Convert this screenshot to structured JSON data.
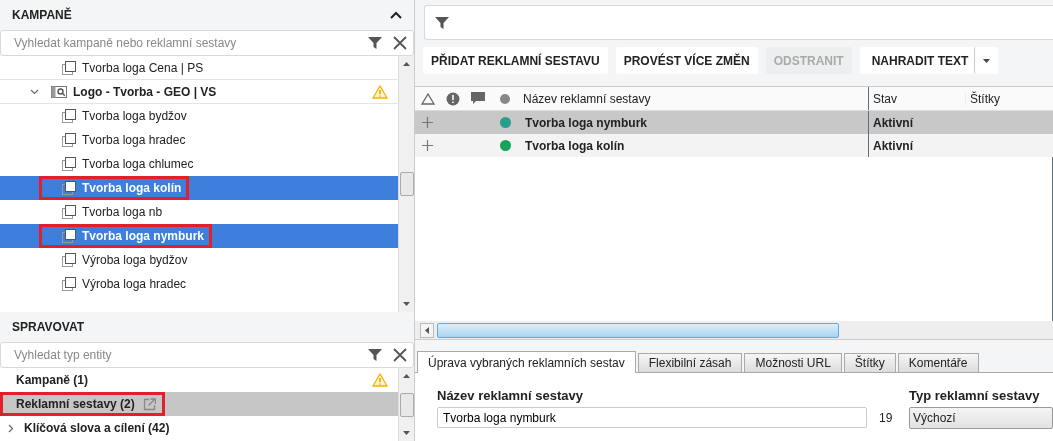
{
  "campaigns_panel": {
    "title": "KAMPANĚ",
    "search": {
      "placeholder": "Vyhledat kampaně nebo reklamní sestavy"
    },
    "tree": [
      {
        "kind": "adgroup",
        "label": "Tvorba loga Cena | PS",
        "selected": false,
        "highlighted": false
      },
      {
        "kind": "campaign",
        "label": "Logo - Tvorba - GEO | VS",
        "selected": false,
        "highlighted": false,
        "expanded": true,
        "warning": true,
        "children": [
          {
            "kind": "adgroup",
            "label": "Tvorba loga bydžov",
            "selected": false,
            "highlighted": false
          },
          {
            "kind": "adgroup",
            "label": "Tvorba loga hradec",
            "selected": false,
            "highlighted": false
          },
          {
            "kind": "adgroup",
            "label": "Tvorba loga chlumec",
            "selected": false,
            "highlighted": false
          },
          {
            "kind": "adgroup",
            "label": "Tvorba loga kolín",
            "selected": true,
            "highlighted": true
          },
          {
            "kind": "adgroup",
            "label": "Tvorba loga nb",
            "selected": false,
            "highlighted": false
          },
          {
            "kind": "adgroup",
            "label": "Tvorba loga nymburk",
            "selected": true,
            "highlighted": true
          },
          {
            "kind": "adgroup",
            "label": "Výroba loga bydžov",
            "selected": false,
            "highlighted": false
          },
          {
            "kind": "adgroup",
            "label": "Výroba loga hradec",
            "selected": false,
            "highlighted": false
          }
        ]
      }
    ]
  },
  "manage_panel": {
    "title": "SPRAVOVAT",
    "search": {
      "placeholder": "Vyhledat typ entity"
    },
    "items": [
      {
        "label": "Kampaně (1)",
        "selected": false,
        "highlighted": false,
        "warning": true,
        "expandable": false,
        "external_link": false
      },
      {
        "label": "Reklamní sestavy (2)",
        "selected": true,
        "highlighted": true,
        "warning": false,
        "expandable": false,
        "external_link": true
      },
      {
        "label": "Klíčová slova a cílení (42)",
        "selected": false,
        "highlighted": false,
        "warning": false,
        "expandable": true,
        "external_link": false
      }
    ]
  },
  "toolbar": {
    "buttons": [
      {
        "label": "PŘIDAT REKLAMNÍ SESTAVU",
        "disabled": false,
        "dropdown": false
      },
      {
        "label": "PROVÉST VÍCE ZMĚN",
        "disabled": false,
        "dropdown": false
      },
      {
        "label": "ODSTRANIT",
        "disabled": true,
        "dropdown": false
      },
      {
        "label": "NAHRADIT TEXT",
        "disabled": false,
        "dropdown": true
      }
    ]
  },
  "grid": {
    "columns": [
      "Název reklamní sestavy",
      "Stav",
      "Štítky"
    ],
    "rows": [
      {
        "name": "Tvorba loga nymburk",
        "status": "Aktivní",
        "selected": true,
        "color": "#26a08c"
      },
      {
        "name": "Tvorba loga kolín",
        "status": "Aktivní",
        "selected": false,
        "color": "#17a35a"
      }
    ]
  },
  "tabs": [
    {
      "label": "Úprava vybraných reklamních sestav",
      "selected": true
    },
    {
      "label": "Flexibilní zásah",
      "selected": false
    },
    {
      "label": "Možnosti URL",
      "selected": false
    },
    {
      "label": "Štítky",
      "selected": false
    },
    {
      "label": "Komentáře",
      "selected": false
    }
  ],
  "form": {
    "name_label": "Název reklamní sestavy",
    "name_value": "Tvorba loga nymburk",
    "char_count": "19",
    "type_label": "Typ reklamní sestavy",
    "type_value": "Výchozí"
  }
}
